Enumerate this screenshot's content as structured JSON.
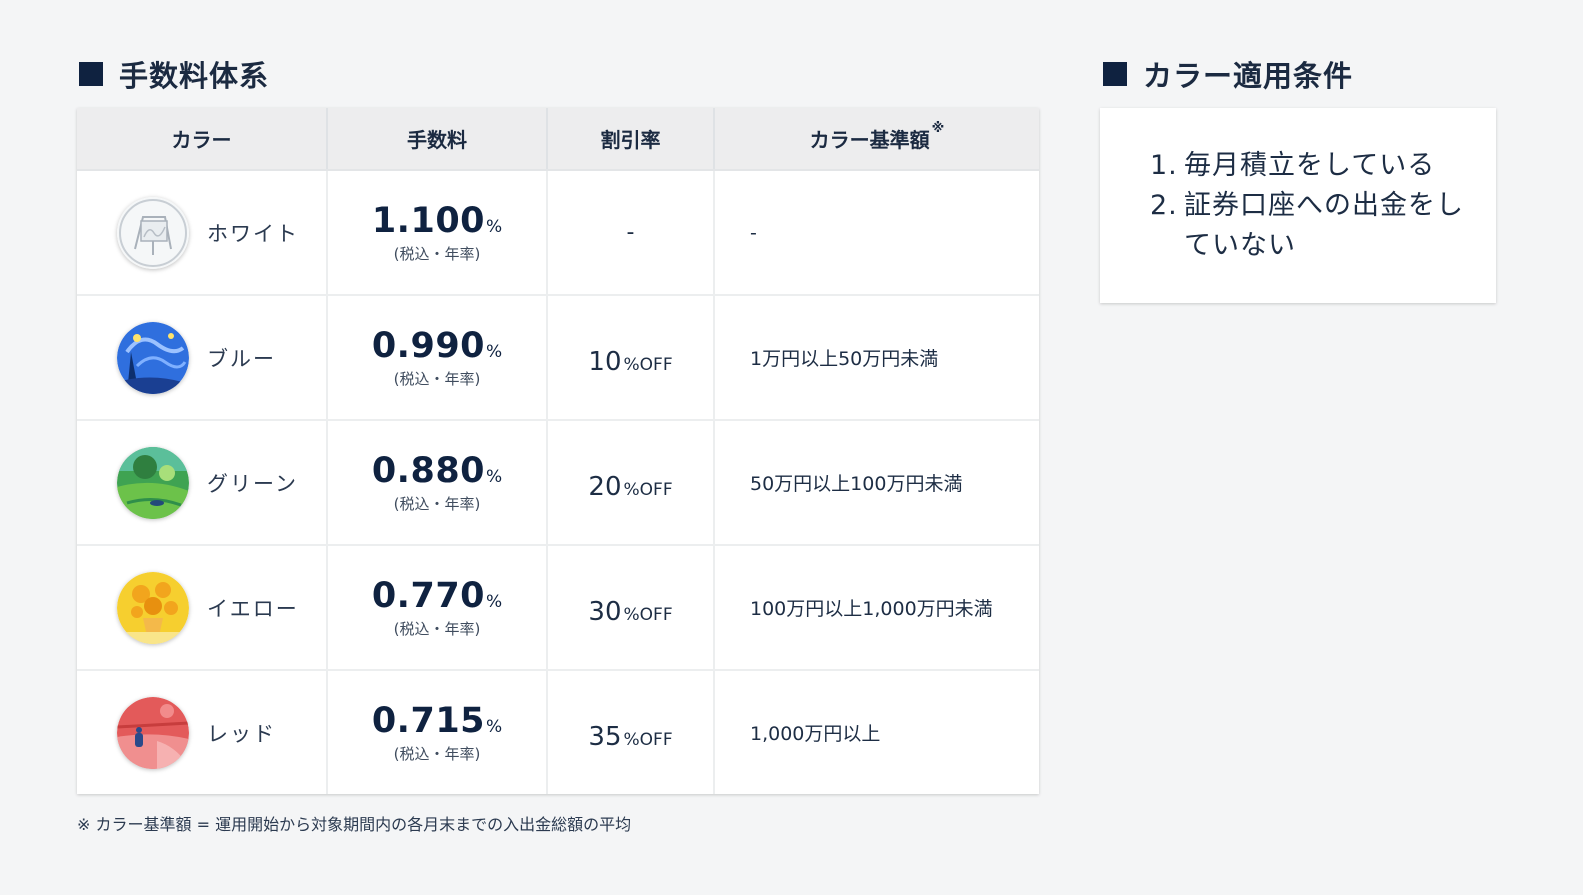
{
  "fee_section": {
    "title": "手数料体系",
    "headers": {
      "color": "カラー",
      "fee": "手数料",
      "discount": "割引率",
      "threshold": "カラー基準額",
      "threshold_mark": "※"
    },
    "fee_unit": "%",
    "fee_note": "(税込・年率)",
    "discount_unit": "%OFF",
    "rows": [
      {
        "color_name": "ホワイト",
        "badge_icon": "white-easel-badge-icon",
        "badge_color": "#dfe4e8",
        "fee": "1.100",
        "discount_num": "",
        "discount_dash": "-",
        "threshold": "-"
      },
      {
        "color_name": "ブルー",
        "badge_icon": "blue-starry-night-badge-icon",
        "badge_color": "#2f6fde",
        "fee": "0.990",
        "discount_num": "10",
        "threshold": "1万円以上50万円未満"
      },
      {
        "color_name": "グリーン",
        "badge_icon": "green-landscape-badge-icon",
        "badge_color": "#3fa352",
        "fee": "0.880",
        "discount_num": "20",
        "threshold": "50万円以上100万円未満"
      },
      {
        "color_name": "イエロー",
        "badge_icon": "yellow-sunflowers-badge-icon",
        "badge_color": "#f6cf2f",
        "fee": "0.770",
        "discount_num": "30",
        "threshold": "100万円以上1,000万円未満"
      },
      {
        "color_name": "レッド",
        "badge_icon": "red-field-badge-icon",
        "badge_color": "#e35a5a",
        "fee": "0.715",
        "discount_num": "35",
        "threshold": "1,000万円以上"
      }
    ],
    "footnote": "※ カラー基準額 = 運用開始から対象期間内の各月末までの入出金総額の平均"
  },
  "conditions_section": {
    "title": "カラー適用条件",
    "items": [
      {
        "num": "1.",
        "text": "毎月積立をしている"
      },
      {
        "num": "2.",
        "text": "証券口座への出金をしていない"
      }
    ]
  },
  "colors": {
    "heading": "#1b2a41",
    "heading_square": "#0f2240",
    "background": "#f4f5f6",
    "table_header_bg": "#ededee"
  }
}
